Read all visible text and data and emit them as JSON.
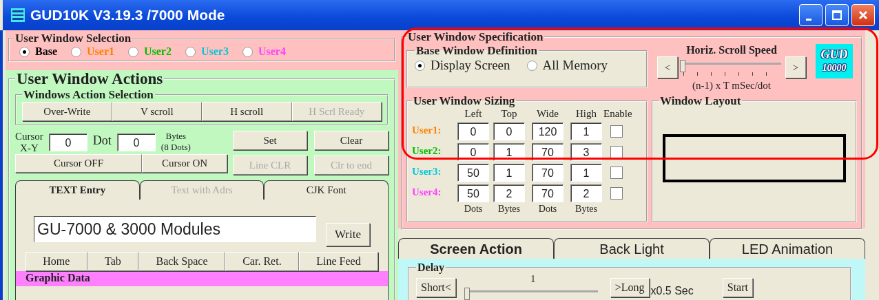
{
  "window": {
    "title": "GUD10K V3.19.3 /7000 Mode"
  },
  "user_window_selection": {
    "title": "User Window Selection",
    "options": [
      {
        "label": "Base",
        "color": "#000000",
        "selected": true
      },
      {
        "label": "User1",
        "color": "#ff8000",
        "selected": false
      },
      {
        "label": "User2",
        "color": "#00c000",
        "selected": false
      },
      {
        "label": "User3",
        "color": "#00c8d8",
        "selected": false
      },
      {
        "label": "User4",
        "color": "#ff40ff",
        "selected": false
      }
    ]
  },
  "user_window_actions": {
    "title": "User Window Actions",
    "action_selection": {
      "title": "Windows Action Selection",
      "buttons": [
        {
          "label": "Over-Write",
          "disabled": false
        },
        {
          "label": "V scroll",
          "disabled": false
        },
        {
          "label": "H scroll",
          "disabled": false
        },
        {
          "label": "H Scrl Ready",
          "disabled": true
        }
      ]
    },
    "cursor": {
      "label_1": "Cursor",
      "label_2": "X-Y",
      "xy_value": "0",
      "dot_label": "Dot",
      "dot_value": "0",
      "unit_1": "Bytes",
      "unit_2": "(8 Dots)"
    },
    "cursor_buttons": [
      {
        "label": "Set",
        "disabled": false
      },
      {
        "label": "Clear",
        "disabled": false
      },
      {
        "label": "Line CLR",
        "disabled": true
      },
      {
        "label": "Clr to end",
        "disabled": true
      }
    ],
    "cursor_toggle_buttons": [
      {
        "label": "Cursor OFF",
        "disabled": false
      },
      {
        "label": "Cursor ON",
        "disabled": false
      }
    ],
    "tabs": [
      {
        "label": "TEXT Entry",
        "selected": true,
        "disabled": false
      },
      {
        "label": "Text with Adrs",
        "selected": false,
        "disabled": true
      },
      {
        "label": "CJK Font",
        "selected": false,
        "disabled": false
      }
    ],
    "text_value": "GU-7000 & 3000 Modules",
    "write_button": "Write",
    "control_buttons": [
      "Home",
      "Tab",
      "Back Space",
      "Car. Ret.",
      "Line Feed"
    ],
    "graphic_data": {
      "title": "Graphic Data"
    }
  },
  "user_window_specification": {
    "title": "User Window Specification",
    "base_window_definition": {
      "title": "Base Window Definition",
      "options": [
        {
          "label": "Display Screen",
          "selected": true
        },
        {
          "label": "All Memory",
          "selected": false
        }
      ]
    },
    "scroll_speed": {
      "title": "Horiz. Scroll Speed",
      "decrease": "<",
      "increase": ">",
      "level": 0.02,
      "caption": "(n-1) x T mSec/dot"
    },
    "logo": {
      "line_1": "GUD",
      "line_2": "10000"
    },
    "sizing": {
      "title": "User Window Sizing",
      "columns": [
        "Left",
        "Top",
        "Wide",
        "High",
        "Enable"
      ],
      "rows": [
        {
          "label": "User1:",
          "color": "#ff8000",
          "values": [
            "0",
            "0",
            "120",
            "1"
          ],
          "enabled": false
        },
        {
          "label": "User2:",
          "color": "#00c000",
          "values": [
            "0",
            "1",
            "70",
            "3"
          ],
          "enabled": false
        },
        {
          "label": "User3:",
          "color": "#00c8d8",
          "values": [
            "50",
            "1",
            "70",
            "1"
          ],
          "enabled": false
        },
        {
          "label": "User4:",
          "color": "#ff40ff",
          "values": [
            "50",
            "2",
            "70",
            "2"
          ],
          "enabled": false
        }
      ],
      "units": [
        "Dots",
        "Bytes",
        "Dots",
        "Bytes"
      ]
    },
    "window_layout": {
      "title": "Window Layout"
    }
  },
  "bottom_tabs": [
    {
      "label": "Screen Action",
      "selected": true
    },
    {
      "label": "Back Light",
      "selected": false
    },
    {
      "label": "LED Animation",
      "selected": false
    }
  ],
  "delay": {
    "title": "Delay",
    "short_button": "Short<",
    "value": "1",
    "level": 0.0,
    "long_button": ">Long",
    "unit": "x0.5 Sec",
    "start_button": "Start"
  }
}
